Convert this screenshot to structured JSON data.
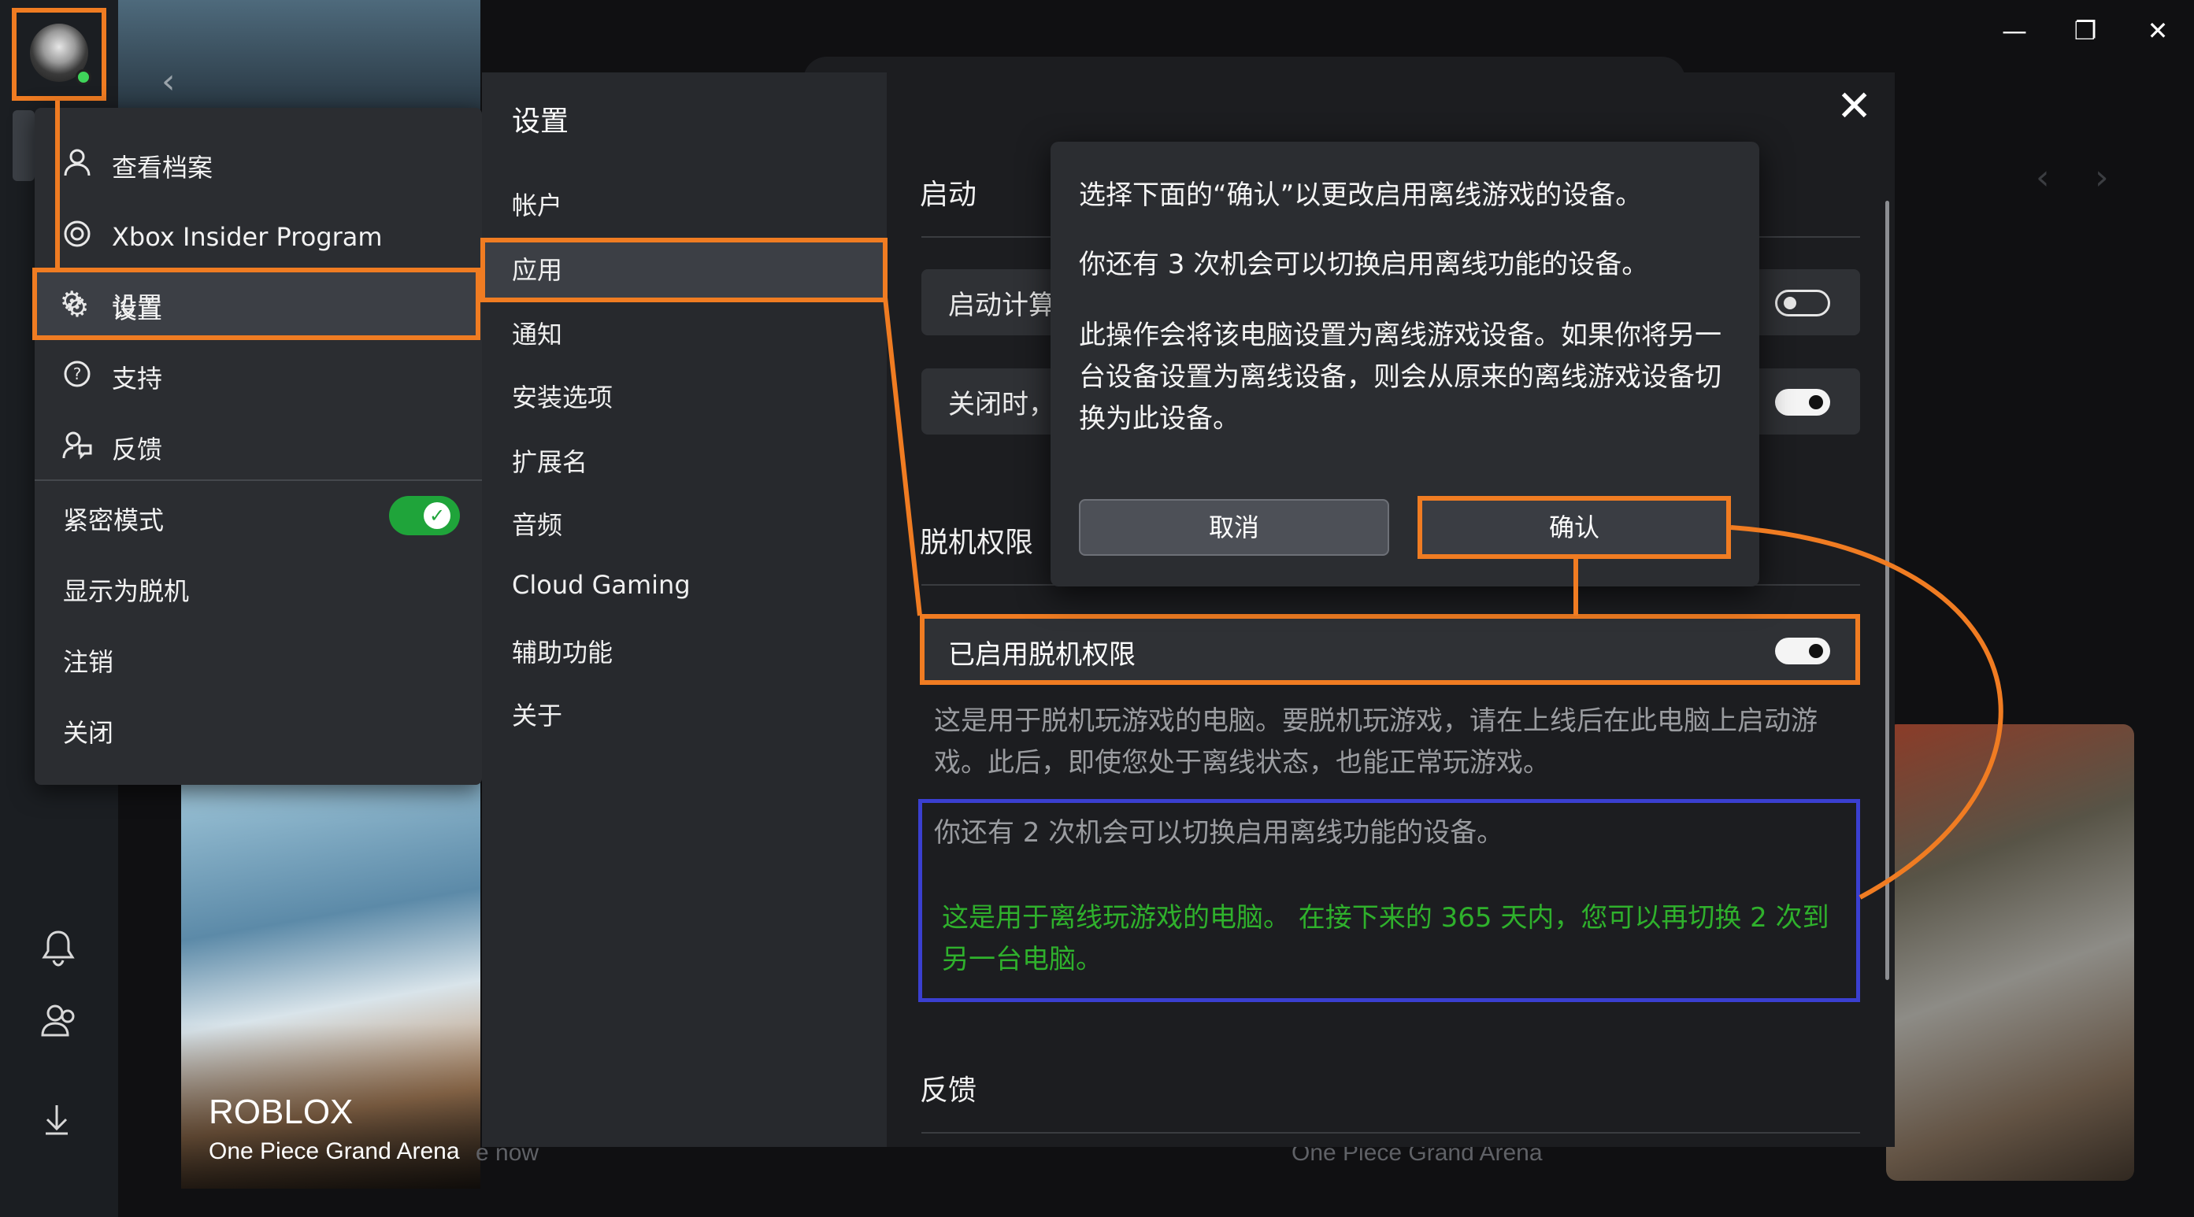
{
  "window_controls": {
    "minimize": "—",
    "maximize": "❐",
    "close": "✕"
  },
  "background": {
    "hero_left_title": "ROBLOX",
    "hero_left_subtitle": "One Piece Grand Arena",
    "faded_now": "e now",
    "faded_subtitle": "One Piece Grand Arena"
  },
  "profile_menu": {
    "items": [
      {
        "label": "查看档案",
        "icon": "person-icon"
      },
      {
        "label": "Xbox Insider Program",
        "icon": "insider-icon"
      },
      {
        "label": "设置",
        "icon": "gear-icon"
      },
      {
        "label": "支持",
        "icon": "help-icon"
      },
      {
        "label": "反馈",
        "icon": "feedback-icon"
      }
    ],
    "strict_mode_label": "紧密模式",
    "strict_mode_on": true,
    "appear_offline": "显示为脱机",
    "sign_out": "注销",
    "close": "关闭"
  },
  "settings": {
    "title": "设置",
    "nav": [
      "帐户",
      "应用",
      "通知",
      "安装选项",
      "扩展名",
      "音频",
      "Cloud Gaming",
      "辅助功能",
      "关于"
    ],
    "selected_nav": "应用",
    "startup_header": "启动",
    "startup_row_label": "启动计算机时",
    "close_row_label": "关闭时，",
    "offline_header": "脱机权限",
    "offline_toggle_label": "已启用脱机权限",
    "offline_description": "这是用于脱机玩游戏的电脑。要脱机玩游戏，请在上线后在此电脑上启动游戏。此后，即使您处于离线状态，也能正常玩游戏。",
    "remaining_changes": "你还有 2 次机会可以切换启用离线功能的设备。",
    "green_note": "这是用于离线玩游戏的电脑。 在接下来的 365 天内，您可以再切换 2 次到另一台电脑。",
    "feedback_header": "反馈"
  },
  "modal": {
    "line1": "选择下面的“确认”以更改启用离线游戏的设备。",
    "line2": "你还有 3 次机会可以切换启用离线功能的设备。",
    "line3": "此操作会将该电脑设置为离线游戏设备。如果你将另一台设备设置为离线设备，则会从原来的离线游戏设备切换为此设备。",
    "cancel": "取消",
    "confirm": "确认"
  },
  "colors": {
    "highlight": "#f07c22",
    "blue_box": "#3a3fd0",
    "green_text": "#2fb12c",
    "toggle_green": "#1fa43a"
  }
}
